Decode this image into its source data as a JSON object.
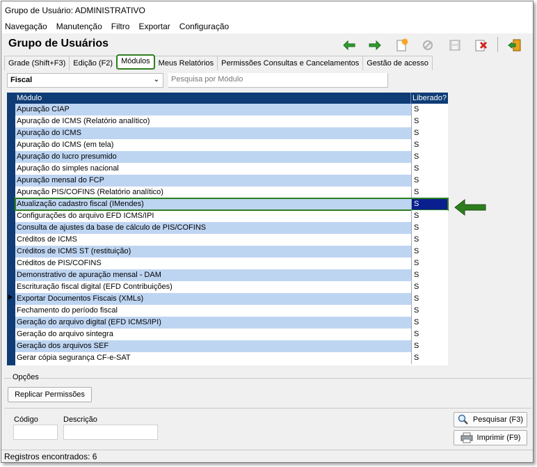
{
  "window": {
    "title": "Grupo de Usuário: ADMINISTRATIVO"
  },
  "menu": [
    "Navegação",
    "Manutenção",
    "Filtro",
    "Exportar",
    "Configuração"
  ],
  "header": {
    "title": "Grupo de Usuários"
  },
  "toolbar": {
    "icons": [
      "back-arrow-icon",
      "forward-arrow-icon",
      "new-record-icon",
      "cancel-icon",
      "save-icon",
      "delete-icon",
      "exit-icon"
    ],
    "accent": "#2e7d1e"
  },
  "tabs": [
    "Grade (Shift+F3)",
    "Edição (F2)",
    "Módulos",
    "Meus Relatórios",
    "Permissões Consultas e Cancelamentos",
    "Gestão de acesso"
  ],
  "filter": {
    "module_group": "Fiscal",
    "search_placeholder": "Pesquisa por Módulo"
  },
  "grid": {
    "columns": [
      "Módulo",
      "Liberado?"
    ],
    "rows": [
      [
        "Apuração CIAP",
        "S"
      ],
      [
        "Apuração de ICMS (Relatório analítico)",
        "S"
      ],
      [
        "Apuração do ICMS",
        "S"
      ],
      [
        "Apuração do ICMS (em tela)",
        "S"
      ],
      [
        "Apuração do lucro presumido",
        "S"
      ],
      [
        "Apuração do simples nacional",
        "S"
      ],
      [
        "Apuração mensal do FCP",
        "S"
      ],
      [
        "Apuração PIS/COFINS (Relatório analítico)",
        "S"
      ],
      [
        "Atualização cadastro fiscal (IMendes)",
        "S"
      ],
      [
        "Configurações do arquivo EFD ICMS/IPI",
        "S"
      ],
      [
        "Consulta de ajustes da base de cálculo de PIS/COFINS",
        "S"
      ],
      [
        "Créditos de ICMS",
        "S"
      ],
      [
        "Créditos de ICMS ST (restituição)",
        "S"
      ],
      [
        "Créditos de PIS/COFINS",
        "S"
      ],
      [
        "Demonstrativo de apuração mensal - DAM",
        "S"
      ],
      [
        "Escrituração fiscal digital (EFD Contribuições)",
        "S"
      ],
      [
        "Exportar Documentos Fiscais (XMLs)",
        "S"
      ],
      [
        "Fechamento do período fiscal",
        "S"
      ],
      [
        "Geração do arquivo digital (EFD ICMS/IPI)",
        "S"
      ],
      [
        "Geração do arquivo sintegra",
        "S"
      ],
      [
        "Geração dos arquivos SEF",
        "S"
      ],
      [
        "Gerar cópia segurança CF-e-SAT",
        "S"
      ]
    ],
    "selected_index": 8,
    "colors": {
      "header": "#0f3c75",
      "alt_row": "#bed5f2",
      "selected_cell": "#0a1f8f"
    }
  },
  "options": {
    "legend": "Opções",
    "replicate_button": "Replicar Permissões"
  },
  "bottom": {
    "code_label": "Código",
    "code_value": "",
    "description_label": "Descrição",
    "description_value": "",
    "search_button": "Pesquisar (F3)",
    "print_button": "Imprimir (F9)"
  },
  "status": {
    "text": "Registros encontrados: 6"
  }
}
